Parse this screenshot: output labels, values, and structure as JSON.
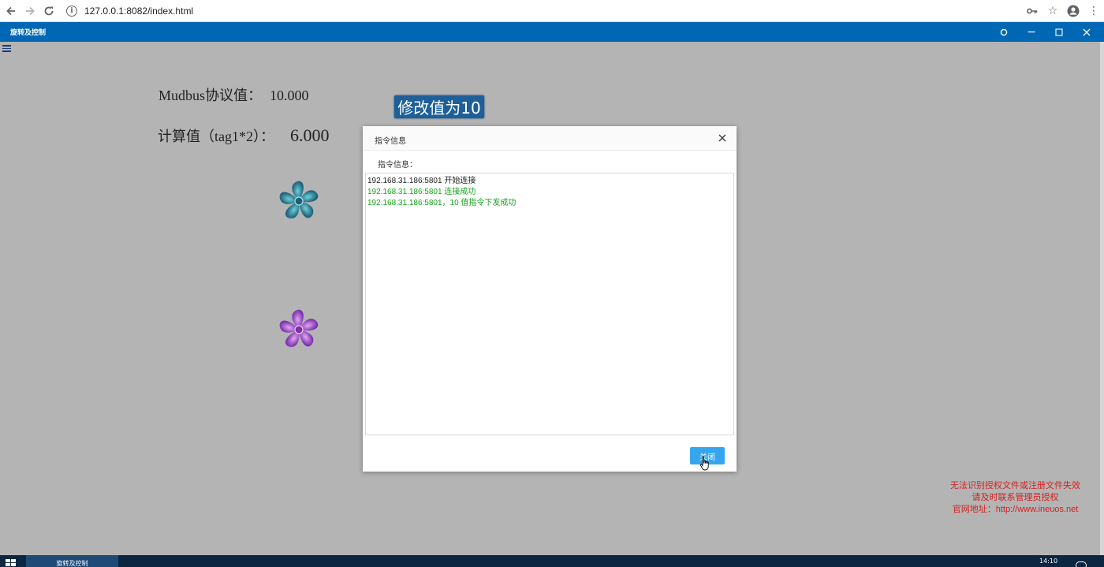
{
  "browser": {
    "url": "127.0.0.1:8082/index.html"
  },
  "app": {
    "title": "旋转及控制"
  },
  "main": {
    "modbus_label": "Mudbus协议值：",
    "modbus_value": "10.000",
    "calc_label": "计算值（tag1*2）：",
    "calc_value": "6.000",
    "modify_button": "修改值为10",
    "fan_colors": {
      "fan1": "#2a8a9e",
      "fan2": "#9a4fc8"
    }
  },
  "dialog": {
    "title": "指令信息",
    "label": "指令信息：",
    "log": [
      {
        "text": "192.168.31.186:5801 开始连接",
        "color": "black"
      },
      {
        "text": "192.168.31.186:5801 连接成功",
        "color": "green"
      },
      {
        "text": "192.168.31.186:5801，10 值指令下发成功",
        "color": "green"
      }
    ],
    "close_button": "关闭"
  },
  "warning": {
    "line1": "无法识别授权文件或注册文件失效",
    "line2": "请及时联系管理员授权",
    "line3": "官网地址：http://www.ineuos.net"
  },
  "taskbar": {
    "task_label": "旋转及控制",
    "clock": "14:10"
  },
  "colors": {
    "accent": "#0067b4",
    "button": "#35a6ee",
    "success": "#16a21b",
    "warning": "#d42020"
  }
}
